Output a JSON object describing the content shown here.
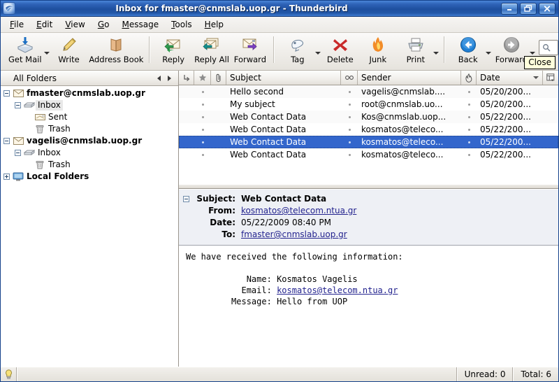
{
  "window": {
    "title": "Inbox for fmaster@cnmslab.uop.gr - Thunderbird",
    "app_icon": "thunderbird-icon",
    "minimize_label": "Minimize",
    "maximize_label": "Restore",
    "close_label": "Close"
  },
  "tooltip": {
    "text": "Close"
  },
  "menubar": {
    "items": [
      {
        "label": "File",
        "accel": "F"
      },
      {
        "label": "Edit",
        "accel": "E"
      },
      {
        "label": "View",
        "accel": "V"
      },
      {
        "label": "Go",
        "accel": "G"
      },
      {
        "label": "Message",
        "accel": "M"
      },
      {
        "label": "Tools",
        "accel": "T"
      },
      {
        "label": "Help",
        "accel": "H"
      }
    ]
  },
  "toolbar": {
    "get_mail": "Get Mail",
    "write": "Write",
    "address_book": "Address Book",
    "reply": "Reply",
    "reply_all": "Reply All",
    "forward": "Forward",
    "tag": "Tag",
    "delete": "Delete",
    "junk": "Junk",
    "print": "Print",
    "back": "Back",
    "forward_nav": "Forward",
    "search_placeholder": ""
  },
  "sidebar": {
    "header_title": "All Folders",
    "nav_prev": "previous",
    "nav_next": "next",
    "tree": [
      {
        "label": "fmaster@cnmslab.uop.gr",
        "icon": "account-mail-icon",
        "level": 0,
        "type": "account",
        "expanded": true,
        "selected": false
      },
      {
        "label": "Inbox",
        "icon": "inbox-icon",
        "level": 1,
        "type": "folder",
        "expanded": true,
        "selected": true
      },
      {
        "label": "Sent",
        "icon": "sent-icon",
        "level": 2,
        "type": "folder",
        "expanded": null,
        "selected": false
      },
      {
        "label": "Trash",
        "icon": "trash-icon",
        "level": 2,
        "type": "folder",
        "expanded": null,
        "selected": false
      },
      {
        "label": "vagelis@cnmslab.uop.gr",
        "icon": "account-mail-icon",
        "level": 0,
        "type": "account",
        "expanded": true,
        "selected": false
      },
      {
        "label": "Inbox",
        "icon": "inbox-icon",
        "level": 1,
        "type": "folder",
        "expanded": true,
        "selected": false
      },
      {
        "label": "Trash",
        "icon": "trash-icon",
        "level": 2,
        "type": "folder",
        "expanded": null,
        "selected": false
      },
      {
        "label": "Local Folders",
        "icon": "local-folders-icon",
        "level": 0,
        "type": "account",
        "expanded": false,
        "selected": false
      }
    ]
  },
  "thread_pane": {
    "columns": {
      "thread": "thread-column-icon",
      "star": "star-column-icon",
      "attachment": "attachment-column-icon",
      "subject": "Subject",
      "read": "read-column-icon",
      "sender": "Sender",
      "junk": "junk-column-icon",
      "date": "Date",
      "picker": "column-picker-icon"
    },
    "sort_column": "Date",
    "rows": [
      {
        "subject": "Hello second",
        "sender": "vagelis@cnmslab....",
        "date": "05/20/200...",
        "selected": false
      },
      {
        "subject": "My subject",
        "sender": "root@cnmslab.uo...",
        "date": "05/20/200...",
        "selected": false
      },
      {
        "subject": "Web Contact Data",
        "sender": "Kos@cnmslab.uop...",
        "date": "05/22/200...",
        "selected": false
      },
      {
        "subject": "Web Contact Data",
        "sender": "kosmatos@teleco...",
        "date": "05/22/200...",
        "selected": false
      },
      {
        "subject": "Web Contact Data",
        "sender": "kosmatos@teleco...",
        "date": "05/22/200...",
        "selected": true
      },
      {
        "subject": "Web Contact Data",
        "sender": "kosmatos@teleco...",
        "date": "05/22/200...",
        "selected": false
      }
    ]
  },
  "message": {
    "subject_label": "Subject:",
    "subject_value": "Web Contact Data",
    "from_label": "From:",
    "from_value": "kosmatos@telecom.ntua.gr",
    "date_label": "Date:",
    "date_value": "05/22/2009 08:40 PM",
    "to_label": "To:",
    "to_value": "fmaster@cnmslab.uop.gr",
    "body_line1": "We have received the following information:",
    "body_line2": "",
    "body_name_label": "   Name:",
    "body_name_value": "Kosmatos Vagelis",
    "body_email_label": "  Email:",
    "body_email_value": "kosmatos@telecom.ntua.gr",
    "body_message_label": "Message:",
    "body_message_value": "Hello from UOP"
  },
  "statusbar": {
    "icon": "lightbulb-icon",
    "message": "",
    "unread": "Unread: 0",
    "total": "Total: 6"
  },
  "colors": {
    "titlebar_blue": "#1e4f9f",
    "selection_blue": "#3366cc",
    "link": "#23238e",
    "tooltip_bg": "#ffffdc",
    "msg_header_bg": "#eef0f5"
  }
}
